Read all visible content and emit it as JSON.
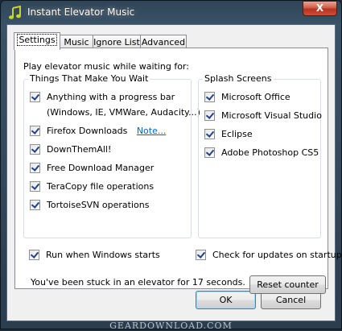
{
  "window": {
    "title": "Instant Elevator Music",
    "close_label": "X"
  },
  "tabs": [
    {
      "label": "Settings"
    },
    {
      "label": "Music"
    },
    {
      "label": "Ignore List"
    },
    {
      "label": "Advanced"
    }
  ],
  "settings": {
    "intro": "Play elevator music while waiting for:",
    "things_group": {
      "title": "Things That Make You Wait",
      "items": [
        {
          "label": "Anything with a progress bar",
          "checked": true
        },
        {
          "label": "Firefox Downloads",
          "checked": true,
          "link": "Note..."
        },
        {
          "label": "DownThemAll!",
          "checked": true
        },
        {
          "label": "Free Download Manager",
          "checked": true
        },
        {
          "label": "TeraCopy file operations",
          "checked": true
        },
        {
          "label": "TortoiseSVN operations",
          "checked": true
        }
      ],
      "progress_note": "(Windows, IE, VMWare, Audacity...)"
    },
    "splash_group": {
      "title": "Splash Screens",
      "items": [
        {
          "label": "Microsoft Office",
          "checked": true
        },
        {
          "label": "Microsoft Visual Studio",
          "checked": true
        },
        {
          "label": "Eclipse",
          "checked": true
        },
        {
          "label": "Adobe Photoshop CS5",
          "checked": true
        }
      ]
    },
    "run_on_start": {
      "label": "Run when Windows starts",
      "checked": true
    },
    "check_updates": {
      "label": "Check for updates on startup",
      "checked": true
    },
    "stuck_text": "You've been stuck in an elevator for 17 seconds.",
    "reset_button": "Reset counter"
  },
  "footer": {
    "ok": "OK",
    "cancel": "Cancel"
  },
  "watermark": "GEARDOWNLOAD.COM",
  "colors": {
    "link": "#0066cc",
    "check": "#21408a",
    "titlebar": "#2f4457"
  }
}
